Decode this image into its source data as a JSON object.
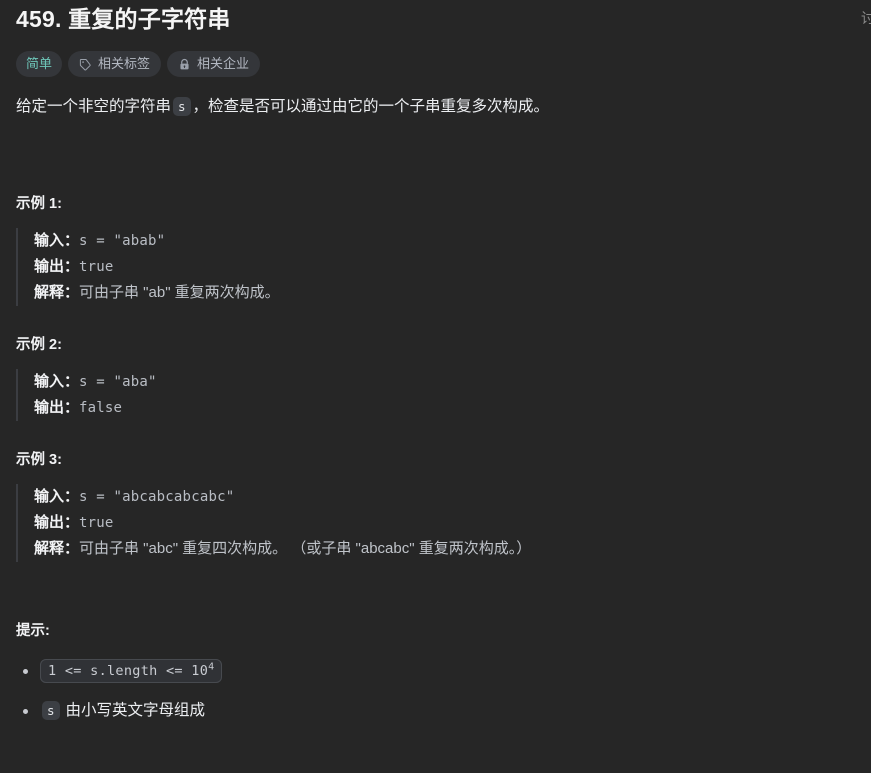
{
  "header": {
    "title": "459. 重复的子字符串",
    "right_cut_text": "讨"
  },
  "badges": [
    {
      "label": "简单",
      "icon": "none",
      "kind": "difficulty"
    },
    {
      "label": "相关标签",
      "icon": "tag-icon",
      "kind": "topic"
    },
    {
      "label": "相关企业",
      "icon": "lock-icon",
      "kind": "company"
    }
  ],
  "description": {
    "part1": "给定一个非空的字符串",
    "code": "s",
    "part2": "，检查是否可以通过由它的一个子串重复多次构成。"
  },
  "examples": [
    {
      "heading": "示例 1:",
      "input_label": "输入：",
      "input_value": "s = \"abab\"",
      "output_label": "输出：",
      "output_value": "true",
      "explain_label": "解释：",
      "explain_value": "可由子串 \"ab\" 重复两次构成。"
    },
    {
      "heading": "示例 2:",
      "input_label": "输入：",
      "input_value": "s = \"aba\"",
      "output_label": "输出：",
      "output_value": "false",
      "explain_label": "",
      "explain_value": ""
    },
    {
      "heading": "示例 3:",
      "input_label": "输入：",
      "input_value": "s = \"abcabcabcabc\"",
      "output_label": "输出：",
      "output_value": "true",
      "explain_label": "解释：",
      "explain_value": "可由子串 \"abc\" 重复四次构成。 （或子串 \"abcabc\" 重复两次构成。）"
    }
  ],
  "hints": {
    "heading": "提示:",
    "items": [
      {
        "code_main": "1 <= s.length <= 10",
        "code_sup": "4",
        "text": ""
      },
      {
        "code_main": "s",
        "code_sup": "",
        "text": "由小写英文字母组成"
      }
    ]
  },
  "colors": {
    "background": "#262626",
    "difficulty_accent": "#6ec6b9",
    "badge_background": "#34363a",
    "text_primary": "#eceef1",
    "text_secondary": "#bfc3c9",
    "border": "#3b3d42"
  }
}
